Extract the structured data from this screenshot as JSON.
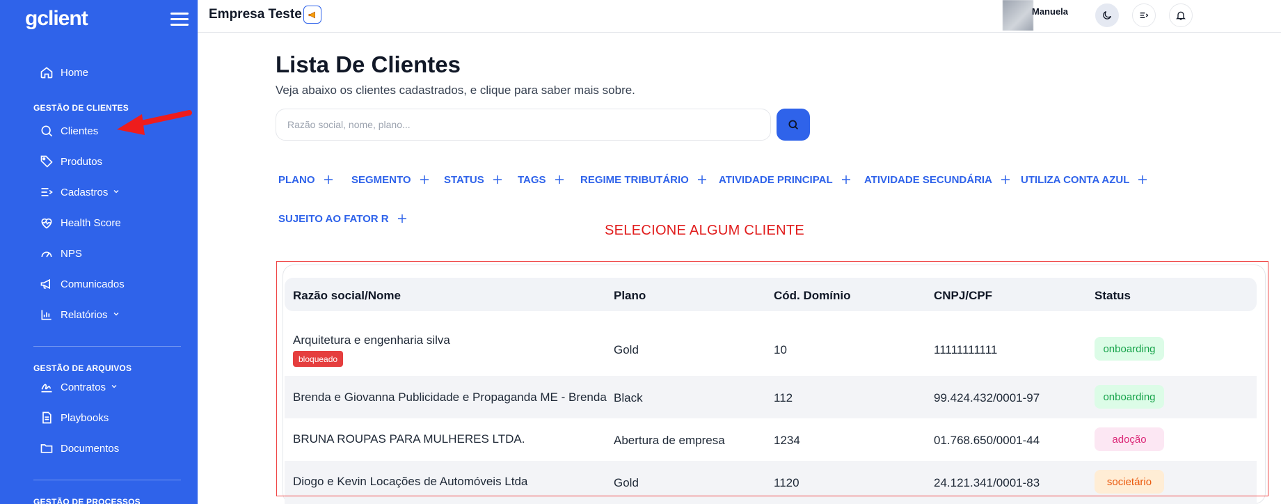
{
  "sidebar": {
    "logo": "gclient",
    "items": [
      {
        "label": "Home",
        "icon": "home-icon"
      },
      {
        "label": "Clientes",
        "icon": "search-icon"
      },
      {
        "label": "Produtos",
        "icon": "tag-icon"
      },
      {
        "label": "Cadastros",
        "icon": "list-icon"
      },
      {
        "label": "Health Score",
        "icon": "heart-pulse-icon"
      },
      {
        "label": "NPS",
        "icon": "gauge-icon"
      },
      {
        "label": "Comunicados",
        "icon": "megaphone-icon"
      },
      {
        "label": "Relatórios",
        "icon": "bar-chart-icon"
      },
      {
        "label": "Contratos",
        "icon": "signature-icon"
      },
      {
        "label": "Playbooks",
        "icon": "document-icon"
      },
      {
        "label": "Documentos",
        "icon": "folder-icon"
      }
    ],
    "sections": {
      "clientes": "GESTÃO DE CLIENTES",
      "arquivos": "GESTÃO DE ARQUIVOS",
      "processos": "GESTÃO DE PROCESSOS"
    }
  },
  "header": {
    "company": "Empresa Teste",
    "user": "Manuela"
  },
  "main": {
    "title": "Lista De Clientes",
    "subtitle": "Veja abaixo os clientes cadastrados, e clique para saber mais sobre.",
    "search_placeholder": "Razão social, nome, plano...",
    "filters": [
      "PLANO",
      "SEGMENTO",
      "STATUS",
      "TAGS",
      "REGIME TRIBUTÁRIO",
      "ATIVIDADE PRINCIPAL",
      "ATIVIDADE SECUNDÁRIA",
      "UTILIZA CONTA AZUL",
      "SUJEITO AO FATOR R"
    ],
    "hint": "SELECIONE ALGUM CLIENTE"
  },
  "table": {
    "columns": [
      "Razão social/Nome",
      "Plano",
      "Cód. Domínio",
      "CNPJ/CPF",
      "Status"
    ],
    "rows": [
      {
        "name": "Arquitetura e engenharia silva",
        "tag": "bloqueado",
        "plan": "Gold",
        "code": "10",
        "doc": "11111111111",
        "status": "onboarding"
      },
      {
        "name": "Brenda e Giovanna Publicidade e Propaganda ME - Brenda",
        "plan": "Black",
        "code": "112",
        "doc": "99.424.432/0001-97",
        "status": "onboarding"
      },
      {
        "name": "BRUNA ROUPAS PARA MULHERES LTDA.",
        "plan": "Abertura de empresa",
        "code": "1234",
        "doc": "01.768.650/0001-44",
        "status": "adoção"
      },
      {
        "name": "Diogo e Kevin Locações de Automóveis Ltda",
        "plan": "Gold",
        "code": "1120",
        "doc": "24.121.341/0001-83",
        "status": "societário"
      }
    ]
  },
  "colors": {
    "primary": "#2f63ea",
    "hint_red": "#e11d1d",
    "status_green": "#16a34a",
    "status_pink": "#db2777",
    "status_orange": "#ea580c"
  }
}
